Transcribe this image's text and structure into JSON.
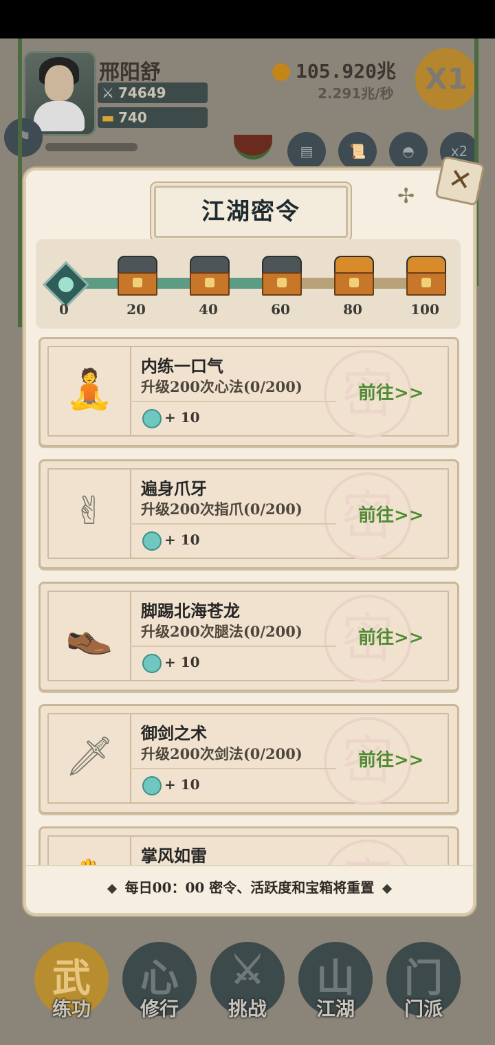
{
  "player": {
    "name": "邢阳舒",
    "power": "74649",
    "ingots": "740",
    "gold": "105.920兆",
    "gold_rate": "2.291兆/秒",
    "speed_label": "X1"
  },
  "dialog": {
    "title": "江湖密令",
    "close_label": "✕",
    "milestones": [
      "0",
      "20",
      "40",
      "60",
      "80",
      "100"
    ],
    "progress_fraction": 0.6,
    "chests_opened": [
      true,
      true,
      true,
      false,
      false
    ],
    "tasks": [
      {
        "name": "内练一口气",
        "desc": "升级200次心法(0/200)",
        "reward": "+ 10",
        "action": "前往>>",
        "icon": "meditation-icon",
        "glyph": "🧘"
      },
      {
        "name": "遍身爪牙",
        "desc": "升级200次指爪(0/200)",
        "reward": "+ 10",
        "action": "前往>>",
        "icon": "hand-gesture-icon",
        "glyph": "✌"
      },
      {
        "name": "脚踢北海苍龙",
        "desc": "升级200次腿法(0/200)",
        "reward": "+ 10",
        "action": "前往>>",
        "icon": "shoe-icon",
        "glyph": "👞"
      },
      {
        "name": "御剑之术",
        "desc": "升级200次剑法(0/200)",
        "reward": "+ 10",
        "action": "前往>>",
        "icon": "sword-icon",
        "glyph": "🗡"
      },
      {
        "name": "掌风如雷",
        "desc": "",
        "reward": "",
        "action": "",
        "icon": "palm-icon",
        "glyph": "✋"
      }
    ],
    "seal_char": "密",
    "footer": "每日00：00 密令、活跃度和宝箱将重置"
  },
  "nav": [
    {
      "label": "练功",
      "glyph": "武",
      "active": true
    },
    {
      "label": "修行",
      "glyph": "心",
      "active": false
    },
    {
      "label": "挑战",
      "glyph": "⚔",
      "active": false
    },
    {
      "label": "江湖",
      "glyph": "山",
      "active": false
    },
    {
      "label": "门派",
      "glyph": "门",
      "active": false
    }
  ]
}
